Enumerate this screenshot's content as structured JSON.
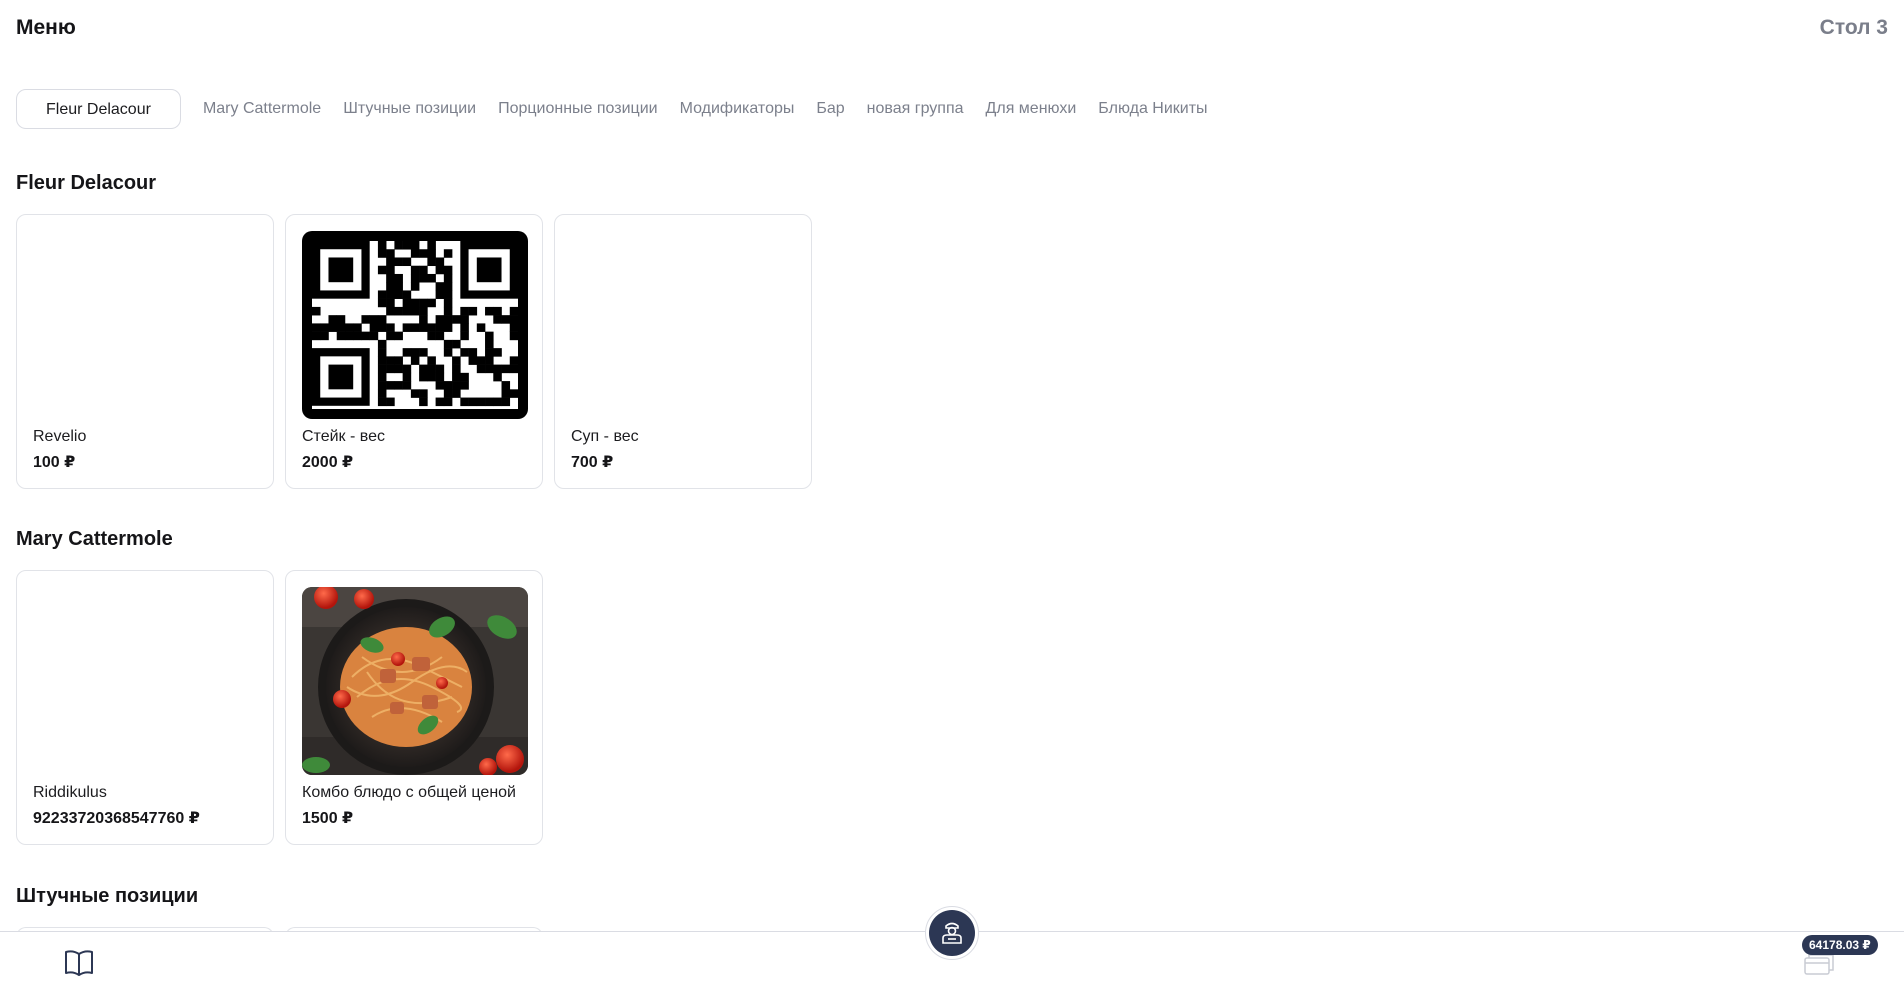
{
  "header": {
    "title": "Меню",
    "table": "Стол 3"
  },
  "tabs": [
    {
      "label": "Fleur Delacour",
      "active": true
    },
    {
      "label": "Mary Cattermole",
      "active": false
    },
    {
      "label": "Штучные позиции",
      "active": false
    },
    {
      "label": "Порционные позиции",
      "active": false
    },
    {
      "label": "Модификаторы",
      "active": false
    },
    {
      "label": "Бар",
      "active": false
    },
    {
      "label": "новая группа",
      "active": false
    },
    {
      "label": "Для менюхи",
      "active": false
    },
    {
      "label": "Блюда Никиты",
      "active": false
    }
  ],
  "sections": [
    {
      "title": "Fleur Delacour",
      "items": [
        {
          "name": "Revelio",
          "price": "100 ₽",
          "image": "none"
        },
        {
          "name": "Стейк - вес",
          "price": "2000 ₽",
          "image": "qr-code"
        },
        {
          "name": "Суп - вес",
          "price": "700 ₽",
          "image": "none"
        }
      ]
    },
    {
      "title": "Mary Cattermole",
      "items": [
        {
          "name": "Riddikulus",
          "price": "92233720368547760 ₽",
          "image": "none"
        },
        {
          "name": "Комбо блюдо с общей ценой",
          "price": "1500 ₽",
          "image": "pasta-dish-photo"
        }
      ]
    },
    {
      "title": "Штучные позиции",
      "items": []
    }
  ],
  "bottom_bar": {
    "menu_icon": "open-book-icon",
    "waiter_icon": "waiter-icon",
    "cart_icon": "card-icon",
    "cart_total": "64178.03 ₽"
  },
  "colors": {
    "accent_dark": "#2c3754",
    "muted_text": "#7c808c",
    "border": "#e1e3e8"
  }
}
